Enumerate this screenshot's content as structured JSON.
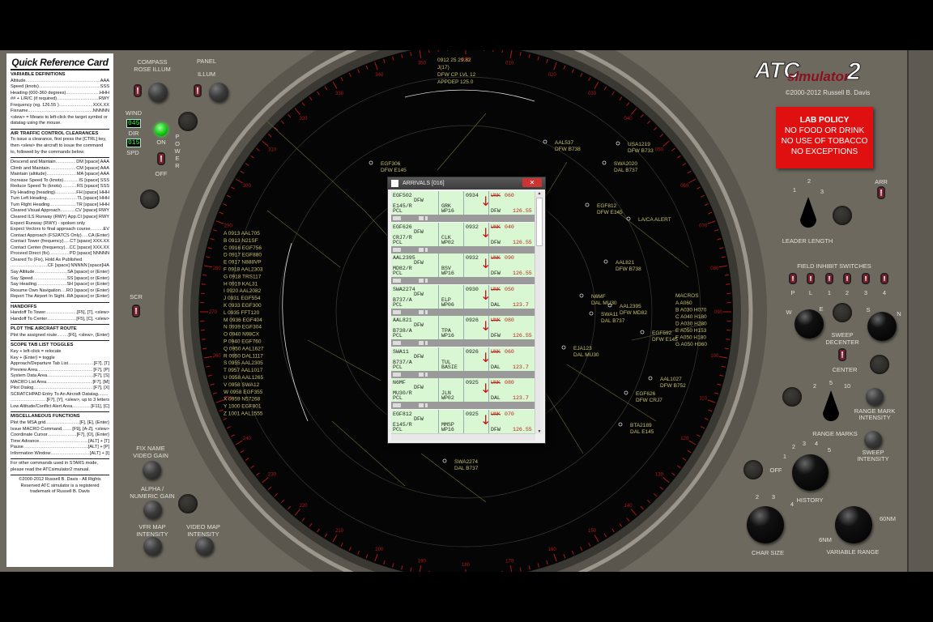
{
  "quick_ref": {
    "title": "Quick Reference Card",
    "sections": [
      {
        "title": "VARIABLE DEFINITIONS",
        "items": [
          {
            "l": "Altitude",
            "r": "AAA"
          },
          {
            "l": "Speed (knots)",
            "r": "SSS"
          },
          {
            "l": "Heading (000-360 degrees)",
            "r": "HHH"
          },
          {
            "l": "## + L/R/C (if required)",
            "r": "RWY"
          },
          {
            "l": "Frequency (eg. 126.55 )",
            "r": "XXX.XX"
          },
          {
            "l": "Fixname",
            "r": "NNNNN"
          },
          {
            "t": "<slew> = Means to left-click the target symbol or datatag using the mouse."
          }
        ]
      },
      {
        "title": "AIR TRAFFIC CONTROL CLEARANCES",
        "items": [
          {
            "t": "To issue a clearance, first press the [CTRL] key, then <slew> the aircraft to issue the command to, followed by the commands below:"
          }
        ]
      },
      {
        "title": "",
        "items": [
          {
            "l": "Descend and Maintain",
            "r": "DM [space] AAA"
          },
          {
            "l": "Climb and Maintain",
            "r": "CM [space] AAA"
          },
          {
            "l": "Maintain (altitude)",
            "r": "MA [space] AAA"
          },
          {
            "l": "Increase Speed To (knots)",
            "r": "IS [space] SSS"
          },
          {
            "l": "Reduce Speed To (knots)",
            "r": "RS [space] SSS"
          },
          {
            "l": "Fly Heading (heading)",
            "r": "FH [space] HHH"
          },
          {
            "l": "Turn Left Heading",
            "r": "TL [space] HHH"
          },
          {
            "l": "Turn Right Heading",
            "r": "TR [space] HHH"
          },
          {
            "l": "Cleared Visual Approach",
            "r": "CV [space] RWY"
          },
          {
            "l": "Cleared ILS Runway (RWY) App.",
            "r": "CI [space] RWY"
          },
          {
            "t": "Expect Runway (RWY) - spoken only"
          },
          {
            "l": "Expect Vectors to final approach course",
            "r": "EV"
          },
          {
            "l": "Contact Approach (FS2ATCS Only)",
            "r": "CA {Enter}"
          },
          {
            "l": "Contact Tower (frequency)",
            "r": "CT [space] XXX.XX"
          },
          {
            "l": "Contact Center (frequency)",
            "r": "CC [space] XXX.XX"
          },
          {
            "l": "Proceed Direct (fix)",
            "r": "PD [space] NNNNN"
          },
          {
            "t": "Cleared To (Fix), Hold As Published"
          },
          {
            "l": "",
            "r": "CF [space] NNNNN [space]HA"
          },
          {
            "l": "Say Altitude",
            "r": "SA [space] or {Enter}"
          },
          {
            "l": "Say Speed",
            "r": "SS [space] or {Enter}"
          },
          {
            "l": "Say Heading",
            "r": "SH [space] or {Enter}"
          },
          {
            "l": "Resume Own Navigation",
            "r": "RO [space] or {Enter}"
          },
          {
            "l": "Report The Airport In Sight",
            "r": "RA [space] or {Enter}"
          }
        ]
      },
      {
        "title": "HANDOFFS",
        "items": [
          {
            "l": "Handoff To Tower",
            "r": "[F5], [T], <slew>"
          },
          {
            "l": "Handoff To Center",
            "r": "[F5], [C], <slew>"
          }
        ]
      },
      {
        "title": "PLOT THE AIRCRAFT ROUTE",
        "items": [
          {
            "l": "Plot the assigned route",
            "r": "[F6], <slew>, {Enter}"
          }
        ]
      },
      {
        "title": "SCOPE TAB LIST TOGGLES",
        "items": [
          {
            "t": "Key + left-click = relocate"
          },
          {
            "t": "Key + {Enter} = toggle"
          },
          {
            "l": "Approach/Departure Tab List",
            "r": "[F7], [T]"
          },
          {
            "l": "Preview Area",
            "r": "[F7], [P]"
          },
          {
            "l": "System Data Area",
            "r": "[F7], [S]"
          },
          {
            "l": "MACRO List Area",
            "r": "[F7], [M]"
          },
          {
            "l": "Pilot Dialog",
            "r": "[F7], [X]"
          },
          {
            "t": "SCRATCHPAD Entry To An Aircraft Datatag........"
          },
          {
            "l": "",
            "r": "[F7], [Y], <slew>, up to 3 letters"
          },
          {
            "l": "Low Altitude/Conflict Alert Area",
            "r": "[F11], [C]"
          }
        ]
      },
      {
        "title": "MISCELLANEOUS FUNCTIONS",
        "items": [
          {
            "l": "Plot the MSA grid",
            "r": "[F], [E], {Enter}"
          },
          {
            "l": "Issue MACRO Command",
            "r": "[F9], [A-Z], <slew>"
          },
          {
            "l": "Coordinate Cursor",
            "r": "[F7], [O], {Enter}"
          },
          {
            "l": "Time Advance",
            "r": "[ALT] + [T]"
          },
          {
            "l": "Pause",
            "r": "[ALT] + [P]"
          },
          {
            "l": "Information Window",
            "r": "[ALT] + [I]"
          }
        ]
      },
      {
        "title": "",
        "items": [
          {
            "t": "For other commands used in STARS mode, please read the ATCsimulator2 manual."
          }
        ]
      }
    ],
    "footer": "©2000-2012 Russell B. Davis - All Rights Reserved ATC simulator is a registered trademark of Russell B. Davis"
  },
  "left_controls": {
    "compass_rose_illum": "COMPASS ROSE ILLUM",
    "panel": "PANEL",
    "illum": "ILLUM",
    "wind": "WIND",
    "wind_dir": "045",
    "dir": "DIR",
    "wind_spd": "015",
    "spd": "SPD",
    "on": "ON",
    "off": "OFF",
    "power": "POWER",
    "scr": "SCR",
    "fix_name": "FIX NAME",
    "video_gain": "VIDEO GAIN",
    "alpha": "ALPHA /",
    "numeric_gain": "NUMERIC GAIN",
    "vfr_map": "VFR MAP",
    "video_map": "VIDEO MAP",
    "intensity": "INTENSITY"
  },
  "right_controls": {
    "logo": "ATC simulator 2",
    "copyright": "©2000-2012 Russell B. Davis",
    "policy": [
      "LAB POLICY",
      "NO FOOD OR DRINK",
      "NO USE OF TOBACCO",
      "NO EXCEPTIONS"
    ],
    "policy_color": "#e01010",
    "leader_length": "LEADER LENGTH",
    "leader_ticks": [
      "1",
      "2",
      "3"
    ],
    "arr": "ARR",
    "field_inhibit": "FIELD INHIBIT SWITCHES",
    "field_labels": [
      "P",
      "L",
      "1",
      "2",
      "3",
      "4"
    ],
    "w": "W",
    "e": "E",
    "s": "S",
    "n": "N",
    "sweep": "SWEEP",
    "decenter": "DECENTER",
    "center": "CENTER",
    "range_ticks": [
      "2",
      "5",
      "10"
    ],
    "range_marks": "RANGE MARKS",
    "range_mark": "RANGE MARK",
    "intensity": "INTENSITY",
    "sweep_int": "SWEEP",
    "history_ticks": [
      "OFF",
      "1",
      "2",
      "3",
      "4",
      "5"
    ],
    "history": "HISTORY",
    "char_ticks": [
      "2",
      "3",
      "4"
    ],
    "char_size": "CHAR SIZE",
    "var_max": "60NM",
    "var_min": "6NM",
    "variable_range": "VARIABLE RANGE"
  },
  "scope": {
    "system_data": [
      "0912 25 29.82",
      "J(17)",
      "DFW CP LVL 12",
      "APPDEP 125.0"
    ],
    "tab_list": [
      "A 0913 AAL705",
      "B 0913 N21SF",
      "C 0916 EGF756",
      "D 0917 EGF880",
      "E 0917 N888VP",
      "F 0918 AAL2303",
      "G 0918 TRS117",
      "H 0919 KAL31",
      "I 0920 AAL2082",
      "J 0931 EGF554",
      "K 0933 EGF300",
      "L 0935 FFT120",
      "M 0936 EGF404",
      "N 0939 EGF304",
      "O 0940 N98CX",
      "P 0940 EGF760",
      "Q 0950 AAL1627",
      "R 0950 DAL1117",
      "S 0955 AAL2305",
      "T 0957 AAL1017",
      "U 0958 AAL1265",
      "V 0958 SWA12",
      "W 0958 EGF355",
      "X 0959 N57268",
      "Y 1000 EGF801",
      "Z 1001 AAL1555"
    ],
    "macros_title": "MACROS",
    "macros": [
      "A A060",
      "B A030 H070",
      "C A040 H180",
      "D A030 H280",
      "E A050 H153",
      "F A050 H180",
      "G A050 H360"
    ],
    "datablocks": [
      [
        "EGF306",
        "DFW E145"
      ],
      [
        "AAL537",
        "DFW B738"
      ],
      [
        "USA1219",
        "DFW B733"
      ],
      [
        "SWA2020",
        "DAL B737"
      ],
      [
        "EGF812",
        "DFW E145"
      ],
      [
        "LA/CA ALERT",
        ""
      ],
      [
        "AAL821",
        "DFW B738"
      ],
      [
        "AAL2395",
        "DFW MD82"
      ],
      [
        "N6MF",
        "DAL MU30"
      ],
      [
        "SWA11",
        "DAL B737"
      ],
      [
        "EGF592",
        "DFW E145"
      ],
      [
        "EJA123",
        "DAL MU30"
      ],
      [
        "AAL1027",
        "DFW B752"
      ],
      [
        "EGF626",
        "DFW CRJ7"
      ],
      [
        "BTA2189",
        "DAL E145"
      ],
      [
        "SWA2274",
        "DAL B737"
      ]
    ],
    "range_color": "#b01818",
    "map_color": "#c8c070"
  },
  "arrivals": {
    "title": "ARRIVALS [016]",
    "rows": [
      {
        "cs": "EGF502",
        "dst": "DFW",
        "type": "E145/R",
        "pos": "PCL",
        "fix": "GRK",
        "rwy": "WP16",
        "time": "0934",
        "unk": "UNK",
        "alt": "060",
        "apt": "DFW",
        "freq": "126.55"
      },
      {
        "cs": "EGF626",
        "dst": "DFW",
        "type": "CRJ7/R",
        "pos": "PCL",
        "fix": "CLK",
        "rwy": "WP02",
        "time": "0932",
        "unk": "UNK",
        "alt": "040",
        "apt": "DFW",
        "freq": "126.55"
      },
      {
        "cs": "AAL2395",
        "dst": "DFW",
        "type": "MD82/R",
        "pos": "PCL",
        "fix": "BSV",
        "rwy": "WP16",
        "time": "0932",
        "unk": "UNK",
        "alt": "090",
        "apt": "DFW",
        "freq": "126.55"
      },
      {
        "cs": "SWA2274",
        "dst": "DFW",
        "type": "B737/A",
        "pos": "PCL",
        "fix": "ELP",
        "rwy": "WP06",
        "time": "0930",
        "unk": "UNK",
        "alt": "050",
        "apt": "DAL",
        "freq": "123.7"
      },
      {
        "cs": "AAL821",
        "dst": "DFW",
        "type": "B738/A",
        "pos": "PCL",
        "fix": "TPA",
        "rwy": "WP16",
        "time": "0926",
        "unk": "UNK",
        "alt": "080",
        "apt": "DFW",
        "freq": "126.55"
      },
      {
        "cs": "SWA11",
        "dst": "DFW",
        "type": "B737/A",
        "pos": "PCL",
        "fix": "TUL",
        "rwy": "BASIE",
        "time": "0926",
        "unk": "UNK",
        "alt": "060",
        "apt": "DAL",
        "freq": "123.7"
      },
      {
        "cs": "N6MF",
        "dst": "DFW",
        "type": "MU30/R",
        "pos": "PCL",
        "fix": "JLN",
        "rwy": "WP02",
        "time": "0925",
        "unk": "UNK",
        "alt": "080",
        "apt": "DAL",
        "freq": "123.7"
      },
      {
        "cs": "EGF812",
        "dst": "DFW",
        "type": "E145/R",
        "pos": "PCL",
        "fix": "MMSP",
        "rwy": "WP16",
        "time": "0925",
        "unk": "UNK",
        "alt": "070",
        "apt": "DFW",
        "freq": "126.55"
      }
    ],
    "close_icon": "close-icon",
    "row_bg": "#d8f7d2"
  }
}
